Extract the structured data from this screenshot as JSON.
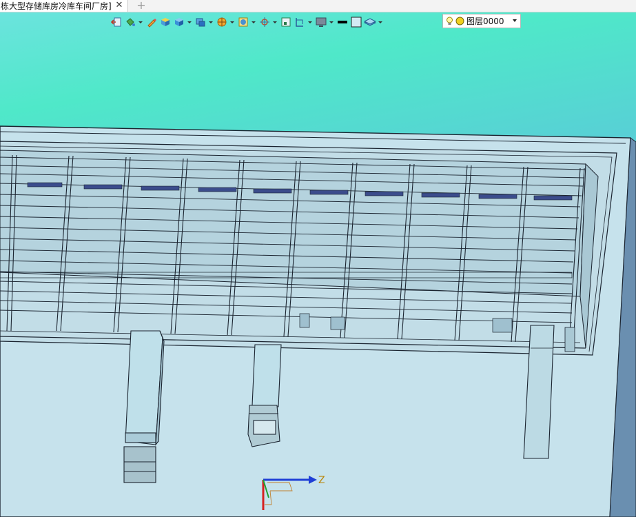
{
  "tab": {
    "title": "栋大型存储库房冷库车间厂房]",
    "close_glyph": "✕",
    "add_glyph": "+"
  },
  "toolbar": {
    "icons": [
      "exit-sketch-icon",
      "paint-bucket-icon",
      "pencil-icon",
      "solid-box-icon",
      "cube-view-icon",
      "display-mode-icon",
      "render-sphere-icon",
      "section-view-icon",
      "orbit-target-icon",
      "fit-view-icon",
      "ruler-icon",
      "monitor-icon",
      "line-color-icon",
      "fill-color-icon",
      "layer-stack-icon"
    ],
    "layer": {
      "bulb": "bulb-icon",
      "value": "图层0000"
    }
  },
  "axis": {
    "z_label": "Z"
  },
  "colors": {
    "tab_bg": "#ffffff",
    "model_fill": "#bfe0ea",
    "model_line": "#1a2630"
  }
}
